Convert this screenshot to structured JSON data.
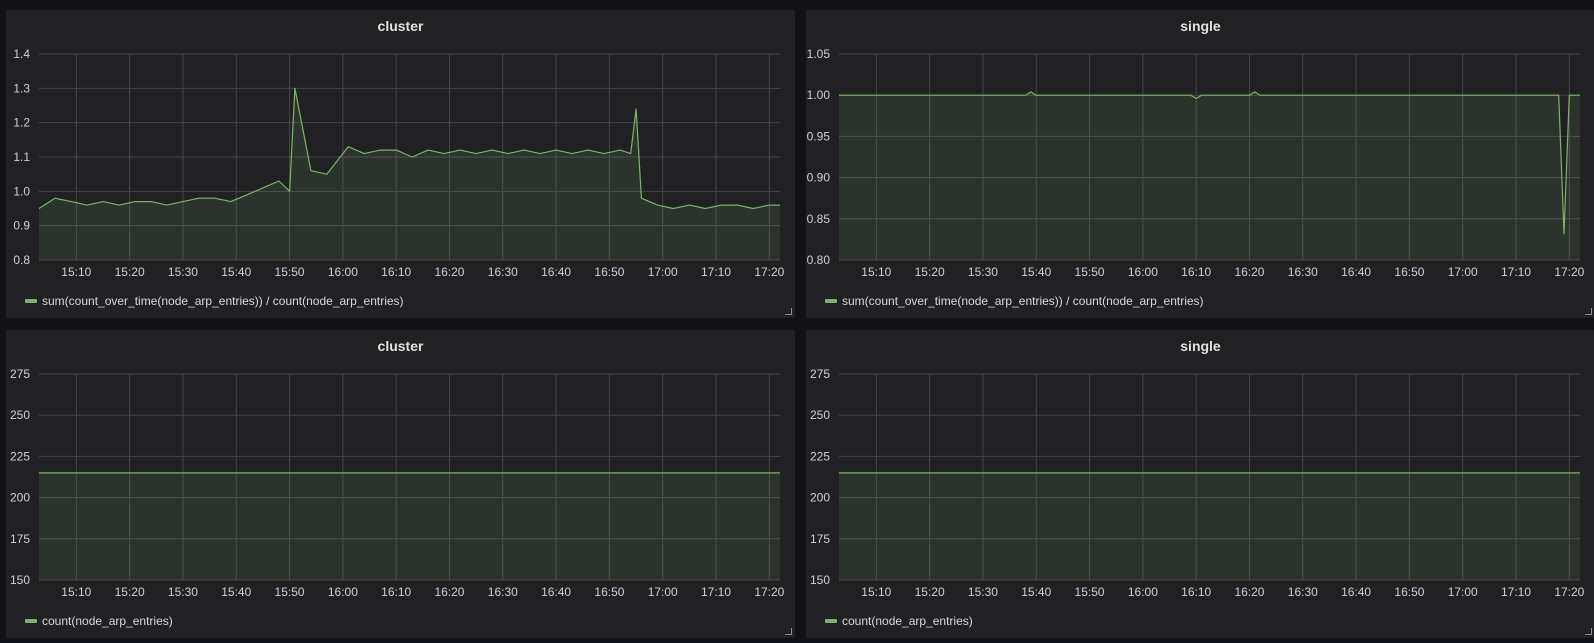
{
  "dashboard": {
    "colors": {
      "page_background": "#111217",
      "panel_background": "#212124",
      "grid": "#464649",
      "series": "#7eb26d",
      "fill": "#2a2e28"
    }
  },
  "chart_data": [
    {
      "type": "line",
      "title": "cluster",
      "legend": "sum(count_over_time(node_arp_entries)) / count(node_arp_entries)",
      "x_ticks": [
        "15:10",
        "15:20",
        "15:30",
        "15:40",
        "15:50",
        "16:00",
        "16:10",
        "16:20",
        "16:30",
        "16:40",
        "16:50",
        "17:00",
        "17:10",
        "17:20"
      ],
      "x_range": [
        "15:03",
        "17:22"
      ],
      "y_ticks": [
        "0.8",
        "0.9",
        "1.0",
        "1.1",
        "1.2",
        "1.3",
        "1.4"
      ],
      "ylim": [
        0.8,
        1.4
      ],
      "grid": true,
      "fill": true,
      "series": [
        {
          "x": [
            "15:03",
            "15:06",
            "15:09",
            "15:12",
            "15:15",
            "15:18",
            "15:21",
            "15:24",
            "15:27",
            "15:30",
            "15:33",
            "15:36",
            "15:39",
            "15:42",
            "15:45",
            "15:48",
            "15:50",
            "15:51",
            "15:54",
            "15:57",
            "15:58",
            "16:01",
            "16:04",
            "16:07",
            "16:10",
            "16:13",
            "16:16",
            "16:19",
            "16:22",
            "16:25",
            "16:28",
            "16:31",
            "16:34",
            "16:37",
            "16:40",
            "16:43",
            "16:46",
            "16:49",
            "16:52",
            "16:54",
            "16:55",
            "16:56",
            "16:59",
            "17:02",
            "17:05",
            "17:08",
            "17:11",
            "17:14",
            "17:17",
            "17:20",
            "17:22"
          ],
          "values": [
            0.95,
            0.98,
            0.97,
            0.96,
            0.97,
            0.96,
            0.97,
            0.97,
            0.96,
            0.97,
            0.98,
            0.98,
            0.97,
            0.99,
            1.01,
            1.03,
            1.0,
            1.3,
            1.06,
            1.05,
            1.07,
            1.13,
            1.11,
            1.12,
            1.12,
            1.1,
            1.12,
            1.11,
            1.12,
            1.11,
            1.12,
            1.11,
            1.12,
            1.11,
            1.12,
            1.11,
            1.12,
            1.11,
            1.12,
            1.11,
            1.24,
            0.98,
            0.96,
            0.95,
            0.96,
            0.95,
            0.96,
            0.96,
            0.95,
            0.96,
            0.96
          ]
        }
      ]
    },
    {
      "type": "line",
      "title": "single",
      "legend": "sum(count_over_time(node_arp_entries)) / count(node_arp_entries)",
      "x_ticks": [
        "15:10",
        "15:20",
        "15:30",
        "15:40",
        "15:50",
        "16:00",
        "16:10",
        "16:20",
        "16:30",
        "16:40",
        "16:50",
        "17:00",
        "17:10",
        "17:20"
      ],
      "x_range": [
        "15:03",
        "17:22"
      ],
      "y_ticks": [
        "0.80",
        "0.85",
        "0.90",
        "0.95",
        "1.00",
        "1.05"
      ],
      "ylim": [
        0.8,
        1.05
      ],
      "grid": true,
      "fill": true,
      "series": [
        {
          "x": [
            "15:03",
            "15:38",
            "15:39",
            "15:40",
            "16:09",
            "16:10",
            "16:11",
            "16:20",
            "16:21",
            "16:22",
            "17:18",
            "17:19",
            "17:20",
            "17:22"
          ],
          "values": [
            1.0,
            1.0,
            1.004,
            1.0,
            1.0,
            0.996,
            1.0,
            1.0,
            1.004,
            1.0,
            1.0,
            0.832,
            1.0,
            1.0
          ]
        }
      ]
    },
    {
      "type": "line",
      "title": "cluster",
      "legend": "count(node_arp_entries)",
      "x_ticks": [
        "15:10",
        "15:20",
        "15:30",
        "15:40",
        "15:50",
        "16:00",
        "16:10",
        "16:20",
        "16:30",
        "16:40",
        "16:50",
        "17:00",
        "17:10",
        "17:20"
      ],
      "x_range": [
        "15:03",
        "17:22"
      ],
      "y_ticks": [
        "150",
        "175",
        "200",
        "225",
        "250",
        "275"
      ],
      "ylim": [
        150,
        275
      ],
      "grid": true,
      "fill": true,
      "series": [
        {
          "x": [
            "15:03",
            "17:22"
          ],
          "values": [
            215,
            215
          ]
        }
      ]
    },
    {
      "type": "line",
      "title": "single",
      "legend": "count(node_arp_entries)",
      "x_ticks": [
        "15:10",
        "15:20",
        "15:30",
        "15:40",
        "15:50",
        "16:00",
        "16:10",
        "16:20",
        "16:30",
        "16:40",
        "16:50",
        "17:00",
        "17:10",
        "17:20"
      ],
      "x_range": [
        "15:03",
        "17:22"
      ],
      "y_ticks": [
        "150",
        "175",
        "200",
        "225",
        "250",
        "275"
      ],
      "ylim": [
        150,
        275
      ],
      "grid": true,
      "fill": true,
      "series": [
        {
          "x": [
            "15:03",
            "17:22"
          ],
          "values": [
            215,
            215
          ]
        }
      ]
    }
  ]
}
